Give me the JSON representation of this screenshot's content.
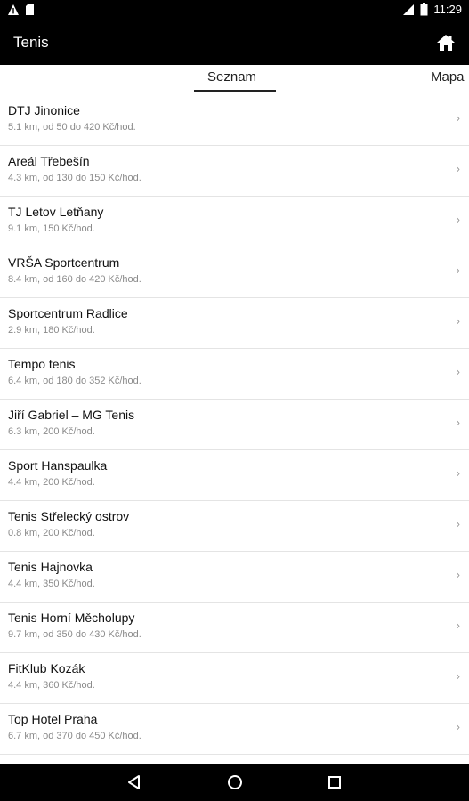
{
  "status_bar": {
    "time": "11:29"
  },
  "app_bar": {
    "title": "Tenis"
  },
  "tabs": [
    {
      "label": "Seznam",
      "selected": true
    },
    {
      "label": "Mapa",
      "selected": false
    }
  ],
  "courts": [
    {
      "name": "DTJ Jinonice",
      "detail": "5.1 km, od 50 do 420 Kč/hod."
    },
    {
      "name": "Areál Třebešín",
      "detail": "4.3 km, od 130 do 150 Kč/hod."
    },
    {
      "name": "TJ Letov Letňany",
      "detail": "9.1 km, 150 Kč/hod."
    },
    {
      "name": "VRŠA Sportcentrum",
      "detail": "8.4 km, od 160 do 420 Kč/hod."
    },
    {
      "name": "Sportcentrum Radlice",
      "detail": "2.9 km, 180 Kč/hod."
    },
    {
      "name": "Tempo tenis",
      "detail": "6.4 km, od 180 do 352 Kč/hod."
    },
    {
      "name": "Jiří Gabriel – MG Tenis",
      "detail": "6.3 km, 200 Kč/hod."
    },
    {
      "name": "Sport Hanspaulka",
      "detail": "4.4 km, 200 Kč/hod."
    },
    {
      "name": "Tenis Střelecký ostrov",
      "detail": "0.8 km, 200 Kč/hod."
    },
    {
      "name": "Tenis Hajnovka",
      "detail": "4.4 km, 350 Kč/hod."
    },
    {
      "name": "Tenis Horní Měcholupy",
      "detail": "9.7 km, od 350 do 430 Kč/hod."
    },
    {
      "name": "FitKlub Kozák",
      "detail": "4.4 km, 360 Kč/hod."
    },
    {
      "name": "Top Hotel Praha",
      "detail": "6.7 km, od 370 do 450 Kč/hod."
    }
  ],
  "chevron": "›",
  "colors": {
    "bar": "#000000",
    "background": "#ffffff",
    "divider": "#e4e4e4",
    "secondary_text": "#8a8a8a"
  },
  "icons": [
    "warning-icon",
    "sd-card-icon",
    "signal-icon",
    "battery-icon",
    "home-icon",
    "back-icon",
    "nav-home-icon",
    "recents-icon"
  ]
}
